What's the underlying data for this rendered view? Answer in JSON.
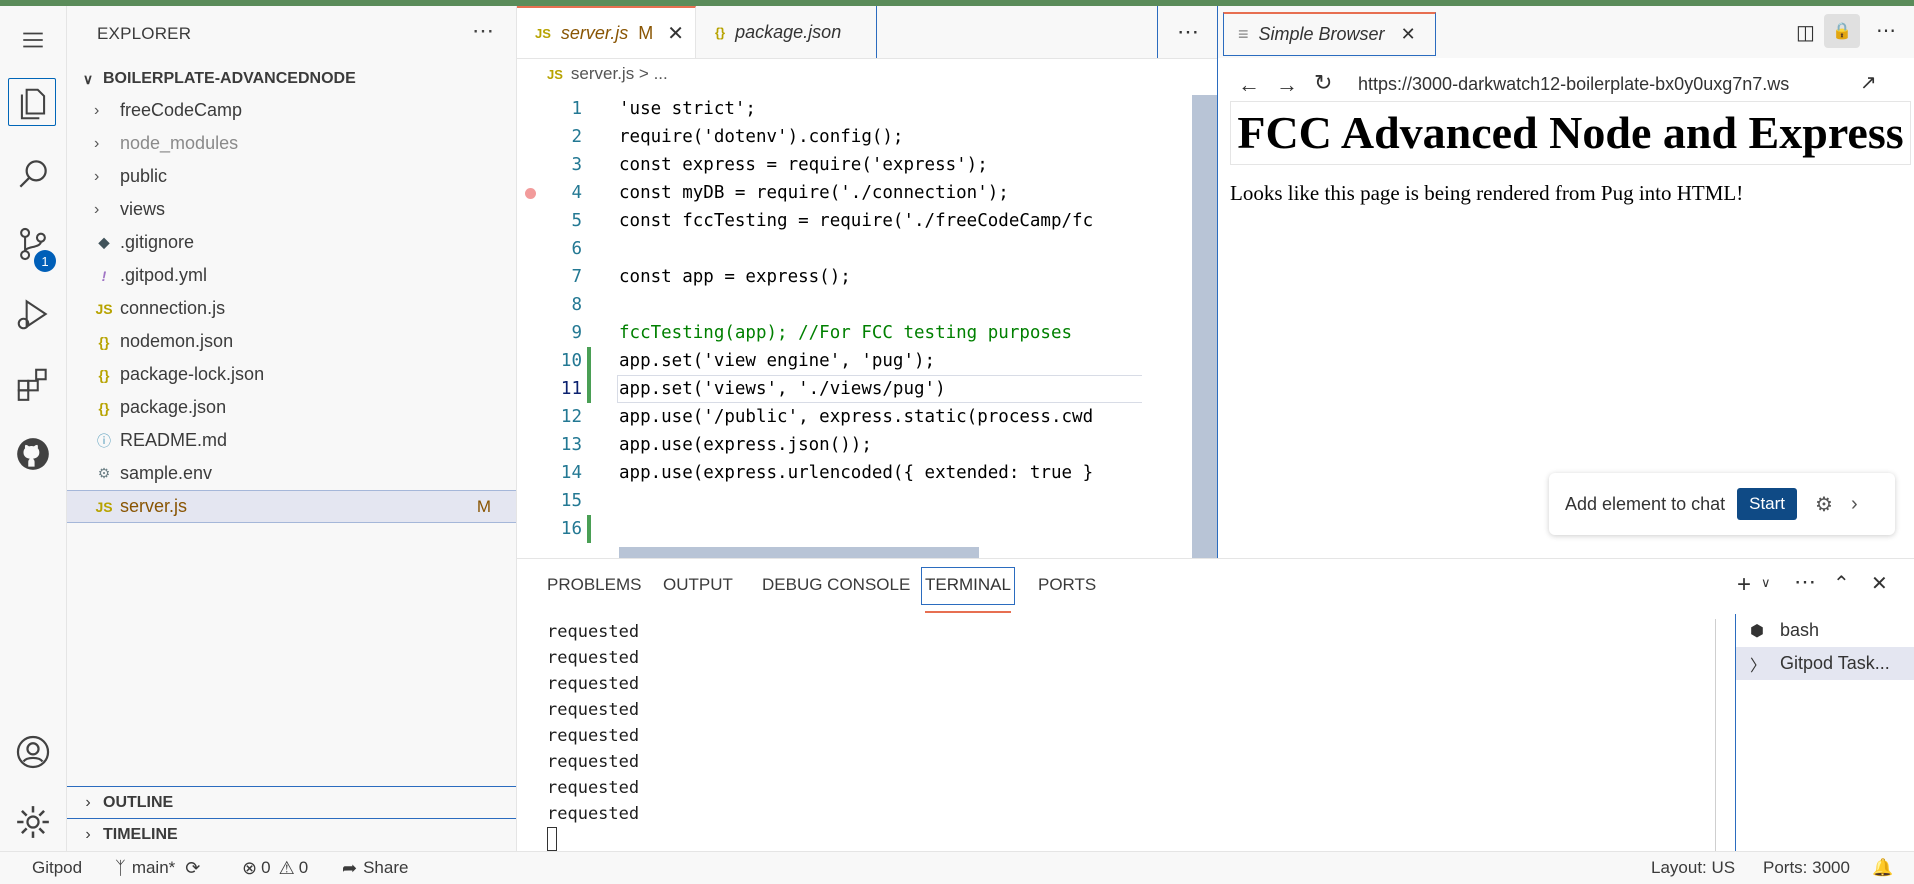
{
  "sidebar": {
    "title": "EXPLORER",
    "more": "⋯",
    "root": "BOILERPLATE-ADVANCEDNODE",
    "folders": [
      "freeCodeCamp",
      "node_modules",
      "public",
      "views"
    ],
    "files": [
      {
        "icon": "◆",
        "name": ".gitignore"
      },
      {
        "icon": "!",
        "name": ".gitpod.yml"
      },
      {
        "icon": "JS",
        "name": "connection.js"
      },
      {
        "icon": "{}",
        "name": "nodemon.json"
      },
      {
        "icon": "{}",
        "name": "package-lock.json"
      },
      {
        "icon": "{}",
        "name": "package.json"
      },
      {
        "icon": "ⓘ",
        "name": "README.md"
      },
      {
        "icon": "⚙",
        "name": "sample.env"
      },
      {
        "icon": "JS",
        "name": "server.js",
        "mark": "M"
      }
    ],
    "sections": [
      "OUTLINE",
      "TIMELINE"
    ]
  },
  "editor": {
    "tabs": [
      {
        "icon": "JS",
        "label": "server.js",
        "mark": "M",
        "close": "✕"
      },
      {
        "icon": "{}",
        "label": "package.json"
      }
    ],
    "more": "⋯",
    "breadcrumb": "server.js > ...",
    "lines": [
      {
        "n": "1",
        "text": "'use strict';"
      },
      {
        "n": "2",
        "text": "require('dotenv').config();"
      },
      {
        "n": "3",
        "text": "const express = require('express');"
      },
      {
        "n": "4",
        "text": "const myDB = require('./connection');"
      },
      {
        "n": "5",
        "text": "const fccTesting = require('./freeCodeCamp/fc"
      },
      {
        "n": "6",
        "text": ""
      },
      {
        "n": "7",
        "text": "const app = express();"
      },
      {
        "n": "8",
        "text": ""
      },
      {
        "n": "9",
        "text": "fccTesting(app); //For FCC testing purposes"
      },
      {
        "n": "10",
        "text": "app.set('view engine', 'pug');"
      },
      {
        "n": "11",
        "text": "app.set('views', './views/pug')"
      },
      {
        "n": "12",
        "text": "app.use('/public', express.static(process.cwd"
      },
      {
        "n": "13",
        "text": "app.use(express.json());"
      },
      {
        "n": "14",
        "text": "app.use(express.urlencoded({ extended: true }"
      },
      {
        "n": "15",
        "text": ""
      },
      {
        "n": "16",
        "text": ""
      }
    ]
  },
  "browser": {
    "tab_label": "Simple Browser",
    "close": "✕",
    "url": "https://3000-darkwatch12-boilerplate-bx0y0uxg7n7.ws",
    "heading": "FCC Advanced Node and Express",
    "paragraph": "Looks like this page is being rendered from Pug into HTML!",
    "chat_label": "Add element to chat",
    "start_label": "Start"
  },
  "panel": {
    "tabs": [
      "PROBLEMS",
      "OUTPUT",
      "DEBUG CONSOLE",
      "TERMINAL",
      "PORTS"
    ],
    "terminal_lines": [
      "requested",
      "requested",
      "requested",
      "requested",
      "requested",
      "requested",
      "requested",
      "requested"
    ],
    "terminals": [
      "bash",
      "Gitpod Task..."
    ]
  },
  "status": {
    "remote": "Gitpod",
    "branch": "main*",
    "errors": "0",
    "warnings": "0",
    "share": "Share",
    "layout": "Layout: US",
    "ports": "Ports: 3000"
  }
}
